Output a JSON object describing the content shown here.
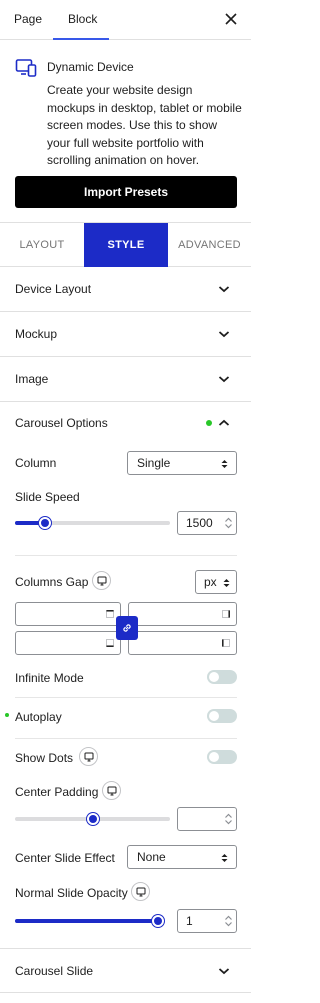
{
  "top_tabs": {
    "page": "Page",
    "block": "Block"
  },
  "block": {
    "title": "Dynamic Device",
    "description": "Create your website design mockups in desktop, tablet or mobile screen modes. Use this to show your full website portfolio with scrolling animation on hover.",
    "import_button": "Import Presets"
  },
  "panel_tabs": {
    "layout": "LAYOUT",
    "style": "STYLE",
    "advanced": "ADVANCED"
  },
  "accordions": {
    "device_layout": "Device Layout",
    "mockup": "Mockup",
    "image": "Image",
    "carousel_options": "Carousel Options",
    "carousel_slide": "Carousel Slide"
  },
  "carousel": {
    "column_label": "Column",
    "column_value": "Single",
    "slide_speed_label": "Slide Speed",
    "slide_speed_value": "1500",
    "slide_speed_fraction": 0.18,
    "columns_gap_label": "Columns Gap",
    "columns_gap_unit": "px",
    "infinite_mode_label": "Infinite Mode",
    "infinite_mode_on": false,
    "autoplay_label": "Autoplay",
    "autoplay_on": false,
    "show_dots_label": "Show Dots",
    "show_dots_on": false,
    "center_padding_label": "Center Padding",
    "center_padding_value": "",
    "center_padding_fraction": 0.5,
    "center_slide_effect_label": "Center Slide Effect",
    "center_slide_effect_value": "None",
    "normal_slide_opacity_label": "Normal Slide Opacity",
    "normal_slide_opacity_value": "1",
    "normal_slide_opacity_fraction": 1.0
  },
  "colors": {
    "accent": "#1c2bc7",
    "status_dot": "#28c728",
    "button": "#000000"
  },
  "icons": [
    "close-icon",
    "device-icon",
    "chevron-down-icon",
    "chevron-up-icon",
    "monitor-icon",
    "link-icon",
    "select-arrows-icon"
  ]
}
